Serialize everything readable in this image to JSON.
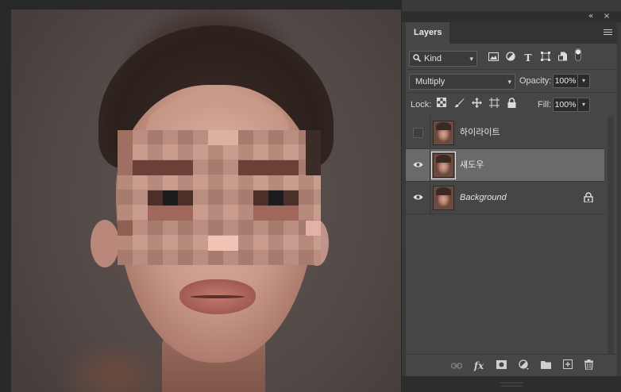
{
  "panel_controls": {
    "collapse_label": "«",
    "close_label": "×"
  },
  "panel": {
    "tab_label": "Layers",
    "filter": {
      "kind_label": "Kind",
      "icons": [
        "image-filter-icon",
        "adjustment-filter-icon",
        "type-filter-icon",
        "shape-filter-icon",
        "smart-object-filter-icon",
        "filter-toggle-icon"
      ]
    },
    "blend": {
      "mode": "Multiply",
      "opacity_label": "Opacity:",
      "opacity_value": "100%"
    },
    "lock": {
      "label": "Lock:",
      "fill_label": "Fill:",
      "fill_value": "100%",
      "icons": [
        "lock-transparent-pixels-icon",
        "lock-image-pixels-icon",
        "lock-position-icon",
        "prevent-auto-nesting-icon",
        "lock-all-icon"
      ]
    },
    "layers": [
      {
        "name": "하이라이트",
        "visible": false,
        "selected": false,
        "locked": false,
        "italic": false
      },
      {
        "name": "섀도우",
        "visible": true,
        "selected": true,
        "locked": false,
        "italic": false
      },
      {
        "name": "Background",
        "visible": true,
        "selected": false,
        "locked": true,
        "italic": true
      }
    ],
    "footer_icons": [
      "link-layers-icon",
      "fx-icon",
      "add-mask-icon",
      "new-adjustment-icon",
      "new-group-icon",
      "new-layer-icon",
      "delete-icon"
    ],
    "fx_label": "fx"
  }
}
